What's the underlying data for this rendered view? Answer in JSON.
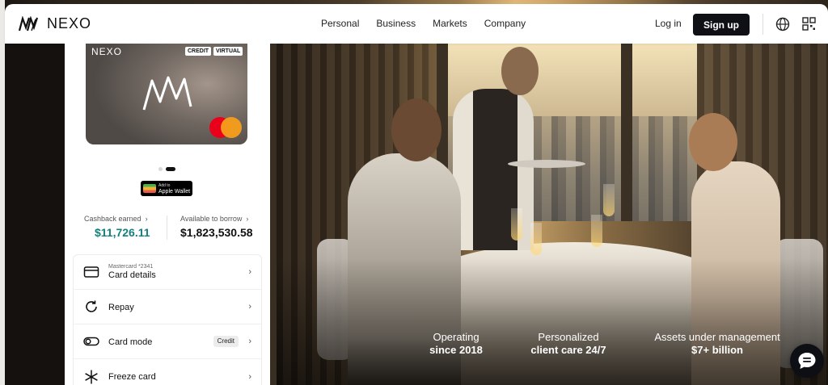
{
  "nav": {
    "logo_text": "NEXO",
    "links": [
      "Personal",
      "Business",
      "Markets",
      "Company"
    ],
    "login": "Log in",
    "signup": "Sign up",
    "icons": [
      "globe-icon",
      "qr-code-icon"
    ]
  },
  "card": {
    "brand": "NEXO",
    "tags": [
      "CREDIT",
      "VIRTUAL"
    ],
    "network": "mastercard"
  },
  "carousel": {
    "total": 2,
    "active_index": 1
  },
  "wallet": {
    "small": "Add to",
    "big": "Apple Wallet"
  },
  "stats": [
    {
      "label": "Cashback earned",
      "value": "$11,726.11",
      "color": "#137f7c"
    },
    {
      "label": "Available to borrow",
      "value": "$1,823,530.58",
      "color": "#111111"
    }
  ],
  "actions": [
    {
      "subtitle": "Mastercard *2341",
      "title": "Card details",
      "icon": "card-icon",
      "badge": ""
    },
    {
      "subtitle": "",
      "title": "Repay",
      "icon": "repay-icon",
      "badge": ""
    },
    {
      "subtitle": "",
      "title": "Card mode",
      "icon": "toggle-icon",
      "badge": "Credit"
    },
    {
      "subtitle": "",
      "title": "Freeze card",
      "icon": "snowflake-icon",
      "badge": ""
    }
  ],
  "hero_stats": [
    {
      "top": "Operating",
      "bottom": "since 2018"
    },
    {
      "top": "Personalized",
      "bottom": "client care 24/7"
    },
    {
      "top": "Assets under management",
      "bottom": "$7+ billion"
    }
  ],
  "colors": {
    "accent_teal": "#137f7c",
    "dark": "#0e1015",
    "mastercard_red": "#eb001b",
    "mastercard_orange": "#f79e1b"
  }
}
